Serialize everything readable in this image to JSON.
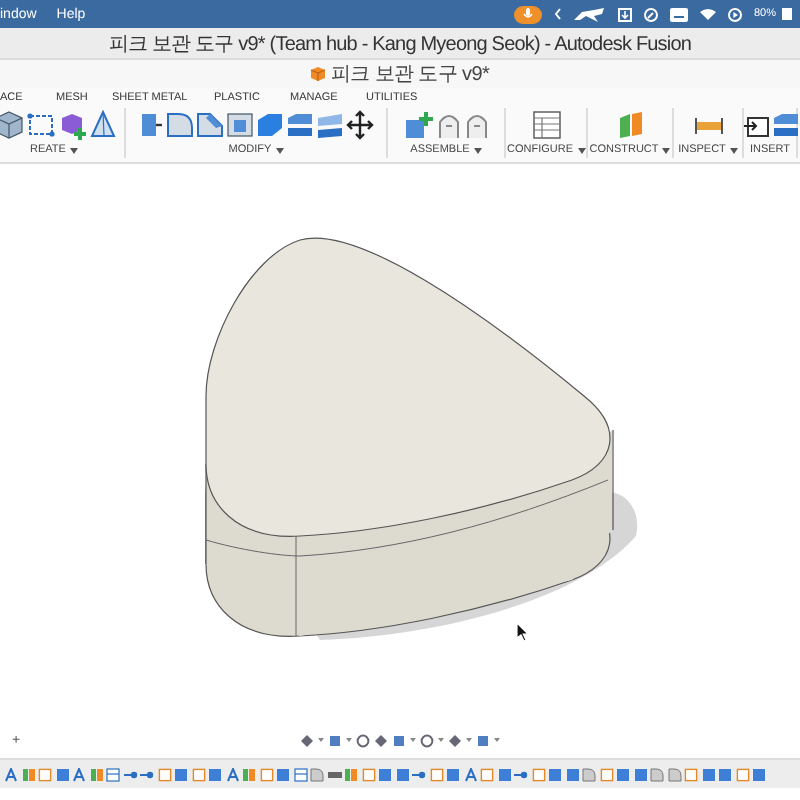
{
  "menu_bar": {
    "items": [
      "indow",
      "Help"
    ],
    "battery": "80%"
  },
  "window": {
    "title": "피크 보관 도구 v9* (Team hub - Kang Myeong Seok) - Autodesk Fusion",
    "document_tab": "피크 보관 도구 v9*"
  },
  "workspace_tabs": [
    "ACE",
    "MESH",
    "SHEET METAL",
    "PLASTIC",
    "MANAGE",
    "UTILITIES"
  ],
  "toolbar_groups": [
    {
      "label": "REATE",
      "dropdown": true
    },
    {
      "label": "MODIFY",
      "dropdown": true
    },
    {
      "label": "ASSEMBLE",
      "dropdown": true
    },
    {
      "label": "CONFIGURE",
      "dropdown": true
    },
    {
      "label": "CONSTRUCT",
      "dropdown": true
    },
    {
      "label": "INSPECT",
      "dropdown": true
    },
    {
      "label": "INSERT",
      "dropdown": false
    }
  ],
  "browser_toggle": "+"
}
